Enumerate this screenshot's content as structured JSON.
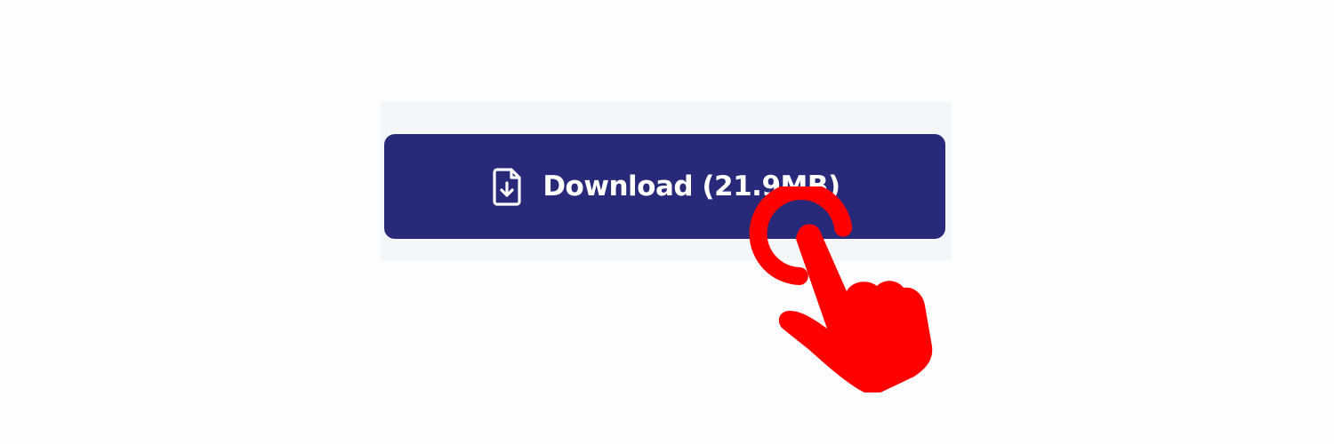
{
  "download_button": {
    "label": "Download (21.9MB)",
    "icon": "file-download-icon",
    "background_color": "#29297a",
    "text_color": "#ffffff"
  },
  "tap_cursor": {
    "icon": "tap-hand-icon",
    "color": "#ff0000"
  },
  "panel": {
    "background_color": "#f5f6f8"
  }
}
